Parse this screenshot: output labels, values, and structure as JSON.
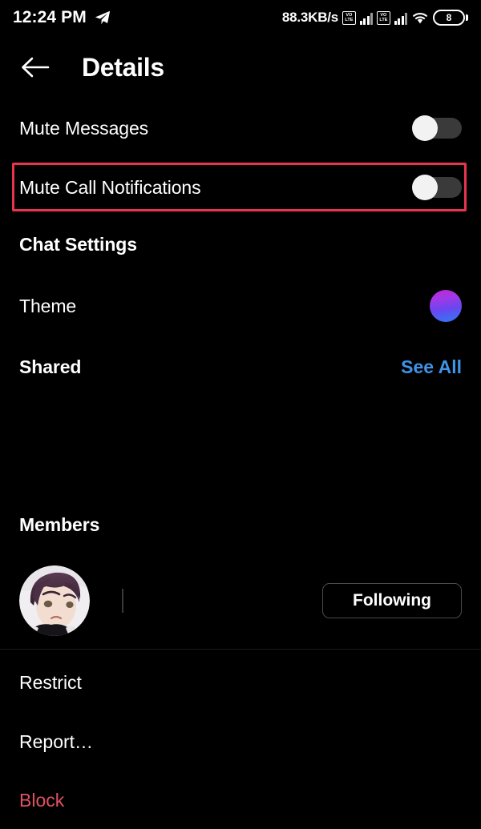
{
  "status_bar": {
    "time": "12:24 PM",
    "app_icon": "telegram-paper-plane-icon",
    "network_speed": "88.3KB/s",
    "sim1_label": "VoLTE",
    "sim2_label": "VoLTE",
    "wifi_icon": "wifi-icon",
    "battery_level": "8"
  },
  "header": {
    "back_icon": "back-arrow-icon",
    "title": "Details"
  },
  "notification_settings": [
    {
      "label": "Mute Messages",
      "toggle_state": "off"
    },
    {
      "label": "Mute Call Notifications",
      "toggle_state": "off"
    }
  ],
  "chat_settings": {
    "section_title": "Chat Settings",
    "theme": {
      "label": "Theme",
      "swatch_colors": [
        "#c026d3",
        "#2b7ef5"
      ]
    }
  },
  "shared": {
    "section_title": "Shared",
    "see_all_label": "See All",
    "see_all_color": "#3f93e8"
  },
  "members": {
    "section_title": "Members",
    "list": [
      {
        "avatar": "anime-character-avatar",
        "username": "",
        "action_label": "Following"
      }
    ]
  },
  "actions": [
    {
      "label": "Restrict",
      "style": "normal"
    },
    {
      "label": "Report…",
      "style": "normal"
    },
    {
      "label": "Block",
      "style": "danger"
    }
  ],
  "colors": {
    "background": "#000000",
    "highlight_box": "#e8344e",
    "danger_text": "#e0525f",
    "link": "#3f93e8",
    "toggle_track": "#3a3a3a",
    "toggle_knob": "#f2f2f2"
  }
}
